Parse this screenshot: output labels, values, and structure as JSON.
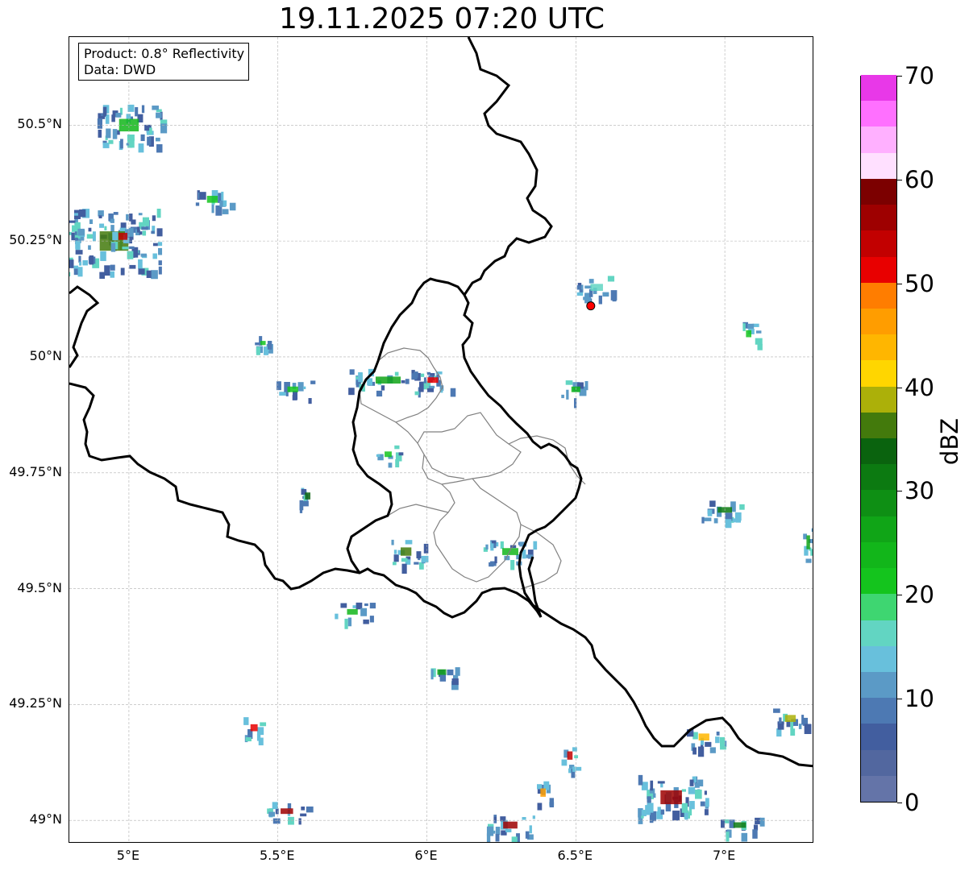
{
  "title": "19.11.2025 07:20 UTC",
  "info": {
    "product": "Product: 0.8° Reflectivity",
    "data_source": "Data: DWD"
  },
  "map": {
    "extent": {
      "lon_min": 4.8,
      "lon_max": 7.3,
      "lat_min": 48.95,
      "lat_max": 50.69
    },
    "lat_ticks": [
      {
        "value": 50.5,
        "label": "50.5°N"
      },
      {
        "value": 50.25,
        "label": "50.25°N"
      },
      {
        "value": 50.0,
        "label": "50°N"
      },
      {
        "value": 49.75,
        "label": "49.75°N"
      },
      {
        "value": 49.5,
        "label": "49.5°N"
      },
      {
        "value": 49.25,
        "label": "49.25°N"
      },
      {
        "value": 49.0,
        "label": "49°N"
      }
    ],
    "lon_ticks": [
      {
        "value": 5.0,
        "label": "5°E"
      },
      {
        "value": 5.5,
        "label": "5.5°E"
      },
      {
        "value": 6.0,
        "label": "6°E"
      },
      {
        "value": 6.5,
        "label": "6.5°E"
      },
      {
        "value": 7.0,
        "label": "7°E"
      }
    ],
    "radar_site": {
      "lon": 6.55,
      "lat": 50.11,
      "color": "#ff0000"
    },
    "gridlines": true,
    "border_color": "#000000",
    "region_border_color": "#808080"
  },
  "colorbar": {
    "unit_label": "dBZ",
    "min": 0,
    "max": 70,
    "ticks": [
      {
        "value": 0,
        "label": "0"
      },
      {
        "value": 10,
        "label": "10"
      },
      {
        "value": 20,
        "label": "20"
      },
      {
        "value": 30,
        "label": "30"
      },
      {
        "value": 40,
        "label": "40"
      },
      {
        "value": 50,
        "label": "50"
      },
      {
        "value": 60,
        "label": "60"
      },
      {
        "value": 70,
        "label": "70"
      }
    ],
    "colors": [
      "#6474a8",
      "#52679f",
      "#425e9f",
      "#4d79b3",
      "#5b9ac6",
      "#68c0dc",
      "#62d5c2",
      "#3ed671",
      "#14c41d",
      "#12b61a",
      "#10a517",
      "#0e8f14",
      "#0c7a11",
      "#0a630e",
      "#437a0c",
      "#acb009",
      "#ffd600",
      "#ffb600",
      "#ff9d00",
      "#ff7d00",
      "#e80000",
      "#c20000",
      "#9e0000",
      "#7c0000",
      "#ffe0ff",
      "#ffb0ff",
      "#ff70ff",
      "#e838e8"
    ]
  },
  "echoes": [
    {
      "lon": 4.95,
      "lat": 50.25,
      "w": 0.32,
      "h": 0.14,
      "level": 14
    },
    {
      "lon": 4.98,
      "lat": 50.26,
      "w": 0.1,
      "h": 0.05,
      "level": 21
    },
    {
      "lon": 5.0,
      "lat": 50.5,
      "w": 0.22,
      "h": 0.09,
      "level": 9
    },
    {
      "lon": 5.28,
      "lat": 50.34,
      "w": 0.12,
      "h": 0.05,
      "level": 8
    },
    {
      "lon": 5.87,
      "lat": 49.95,
      "w": 0.28,
      "h": 0.05,
      "level": 10
    },
    {
      "lon": 6.02,
      "lat": 49.95,
      "w": 0.12,
      "h": 0.04,
      "level": 20
    },
    {
      "lon": 5.55,
      "lat": 49.93,
      "w": 0.12,
      "h": 0.04,
      "level": 8
    },
    {
      "lon": 5.45,
      "lat": 50.03,
      "w": 0.06,
      "h": 0.03,
      "level": 8
    },
    {
      "lon": 5.93,
      "lat": 49.58,
      "w": 0.12,
      "h": 0.06,
      "level": 14
    },
    {
      "lon": 6.28,
      "lat": 49.58,
      "w": 0.18,
      "h": 0.05,
      "level": 9
    },
    {
      "lon": 5.87,
      "lat": 49.79,
      "w": 0.08,
      "h": 0.04,
      "level": 8
    },
    {
      "lon": 5.6,
      "lat": 49.7,
      "w": 0.06,
      "h": 0.05,
      "level": 13
    },
    {
      "lon": 5.75,
      "lat": 49.45,
      "w": 0.12,
      "h": 0.04,
      "level": 9
    },
    {
      "lon": 6.05,
      "lat": 49.32,
      "w": 0.1,
      "h": 0.04,
      "level": 10
    },
    {
      "lon": 6.5,
      "lat": 49.93,
      "w": 0.1,
      "h": 0.04,
      "level": 9
    },
    {
      "lon": 7.0,
      "lat": 49.67,
      "w": 0.16,
      "h": 0.04,
      "level": 12
    },
    {
      "lon": 7.28,
      "lat": 49.6,
      "w": 0.04,
      "h": 0.1,
      "level": 10
    },
    {
      "lon": 7.22,
      "lat": 49.22,
      "w": 0.12,
      "h": 0.05,
      "level": 15
    },
    {
      "lon": 6.93,
      "lat": 49.18,
      "w": 0.12,
      "h": 0.05,
      "level": 17
    },
    {
      "lon": 5.42,
      "lat": 49.2,
      "w": 0.08,
      "h": 0.05,
      "level": 20
    },
    {
      "lon": 5.53,
      "lat": 49.02,
      "w": 0.14,
      "h": 0.04,
      "level": 22
    },
    {
      "lon": 6.28,
      "lat": 48.99,
      "w": 0.16,
      "h": 0.05,
      "level": 22
    },
    {
      "lon": 6.39,
      "lat": 49.06,
      "w": 0.06,
      "h": 0.06,
      "level": 18
    },
    {
      "lon": 6.48,
      "lat": 49.14,
      "w": 0.06,
      "h": 0.06,
      "level": 21
    },
    {
      "lon": 6.82,
      "lat": 49.05,
      "w": 0.24,
      "h": 0.1,
      "level": 22
    },
    {
      "lon": 7.05,
      "lat": 48.99,
      "w": 0.14,
      "h": 0.04,
      "level": 12
    },
    {
      "lon": 6.57,
      "lat": 50.15,
      "w": 0.14,
      "h": 0.05,
      "level": 6
    },
    {
      "lon": 7.08,
      "lat": 50.05,
      "w": 0.06,
      "h": 0.05,
      "level": 8
    }
  ]
}
